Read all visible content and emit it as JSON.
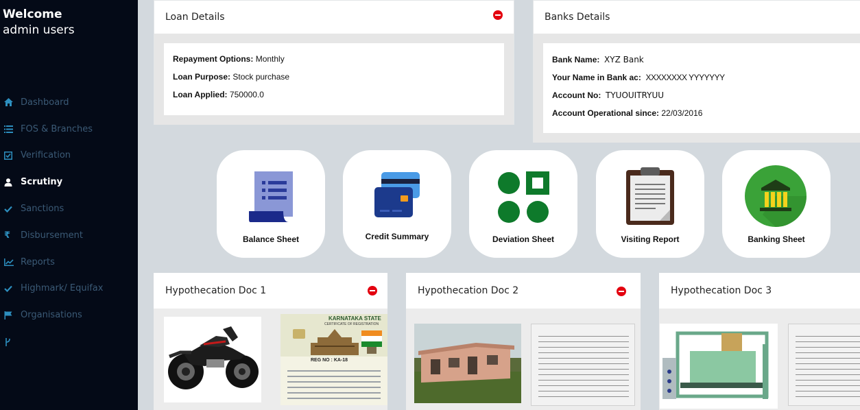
{
  "sidebar": {
    "welcome_line1": "Welcome",
    "welcome_line2": "admin users",
    "items": [
      {
        "label": "Dashboard",
        "icon": "home-icon"
      },
      {
        "label": "FOS & Branches",
        "icon": "list-icon"
      },
      {
        "label": "Verification",
        "icon": "check-square-icon"
      },
      {
        "label": "Scrutiny",
        "icon": "user-icon"
      },
      {
        "label": "Sanctions",
        "icon": "check-icon"
      },
      {
        "label": "Disbursement",
        "icon": "rupee-icon"
      },
      {
        "label": "Reports",
        "icon": "line-chart-icon"
      },
      {
        "label": "Highmark/ Equifax",
        "icon": "check-icon"
      },
      {
        "label": "Organisations",
        "icon": "flag-icon"
      }
    ]
  },
  "loan": {
    "title": "Loan Details",
    "repayment_label": "Repayment Options:",
    "repayment_value": "Monthly",
    "purpose_label": "Loan Purpose:",
    "purpose_value": "Stock purchase",
    "applied_label": "Loan Applied:",
    "applied_value": "750000.0"
  },
  "bank": {
    "title": "Banks Details",
    "name_label": "Bank Name:",
    "name_value": "XYZ Bank",
    "holder_label": "Your Name in Bank ac:",
    "holder_value": "XXXXXXXX YYYYYYY",
    "account_label": "Account No:",
    "account_value": "TYUOUITRYUU",
    "since_label": "Account Operational since:",
    "since_value": "22/03/2016"
  },
  "tiles": {
    "balance": "Balance Sheet",
    "credit": "Credit Summary",
    "deviation": "Deviation Sheet",
    "visiting": "Visiting Report",
    "banking": "Banking Sheet"
  },
  "docs": {
    "doc1": "Hypothecation Doc 1",
    "doc2": "Hypothecation Doc 2",
    "doc3": "Hypothecation Doc 3",
    "card_header": "KARNATAKA STATE",
    "card_sub": "CERTIFICATE OF REGISTRATION",
    "reg_no": "REG NO : KA-18"
  },
  "colors": {
    "sidebar_bg": "#040a17",
    "accent_blue": "#2d8fbf",
    "remove_red": "#e3000f",
    "deviation_green": "#0e7a2b",
    "banking_green": "#3aa238"
  }
}
